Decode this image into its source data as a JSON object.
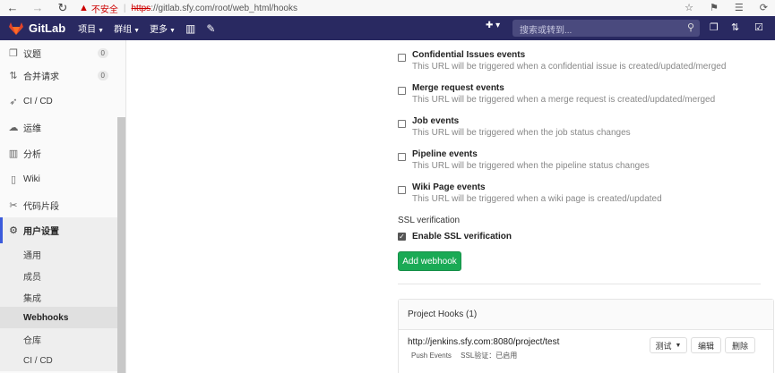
{
  "browser": {
    "warning_text": "不安全",
    "url_protocol": "https",
    "url_rest": "://gitlab.sfy.com/root/web_html/hooks"
  },
  "navbar": {
    "brand": "GitLab",
    "menu": [
      {
        "label": "项目"
      },
      {
        "label": "群组"
      },
      {
        "label": "更多"
      }
    ],
    "search_placeholder": "搜索或转到..."
  },
  "sidebar": {
    "items": [
      {
        "label": "议题",
        "count": "0",
        "icon": "issues-icon"
      },
      {
        "label": "合并请求",
        "count": "0",
        "icon": "merge-request-icon"
      },
      {
        "label": "CI / CD",
        "icon": "rocket-icon"
      },
      {
        "label": "运维",
        "icon": "cloud-icon"
      },
      {
        "label": "分析",
        "icon": "chart-icon"
      },
      {
        "label": "Wiki",
        "icon": "book-icon"
      },
      {
        "label": "代码片段",
        "icon": "scissors-icon"
      },
      {
        "label": "用户设置",
        "icon": "gear-icon"
      }
    ],
    "sub_items": [
      {
        "label": "通用"
      },
      {
        "label": "成员"
      },
      {
        "label": "集成"
      },
      {
        "label": "Webhooks"
      },
      {
        "label": "仓库"
      },
      {
        "label": "CI / CD"
      }
    ]
  },
  "events": [
    {
      "title": "Confidential Issues events",
      "desc": "This URL will be triggered when a confidential issue is created/updated/merged"
    },
    {
      "title": "Merge request events",
      "desc": "This URL will be triggered when a merge request is created/updated/merged"
    },
    {
      "title": "Job events",
      "desc": "This URL will be triggered when the job status changes"
    },
    {
      "title": "Pipeline events",
      "desc": "This URL will be triggered when the pipeline status changes"
    },
    {
      "title": "Wiki Page events",
      "desc": "This URL will be triggered when a wiki page is created/updated"
    }
  ],
  "ssl": {
    "heading": "SSL verification",
    "label": "Enable SSL verification",
    "checked": true
  },
  "add_webhook_label": "Add webhook",
  "project_hooks": {
    "title": "Project Hooks (1)",
    "hook": {
      "url": "http://jenkins.sfy.com:8080/project/test",
      "event": "Push Events",
      "ssl_label": "SSL验证：已启用",
      "test_label": "测试",
      "edit_label": "编辑",
      "delete_label": "删除"
    }
  },
  "colors": {
    "navbar": "#292961",
    "add_button": "#1aaa55"
  }
}
